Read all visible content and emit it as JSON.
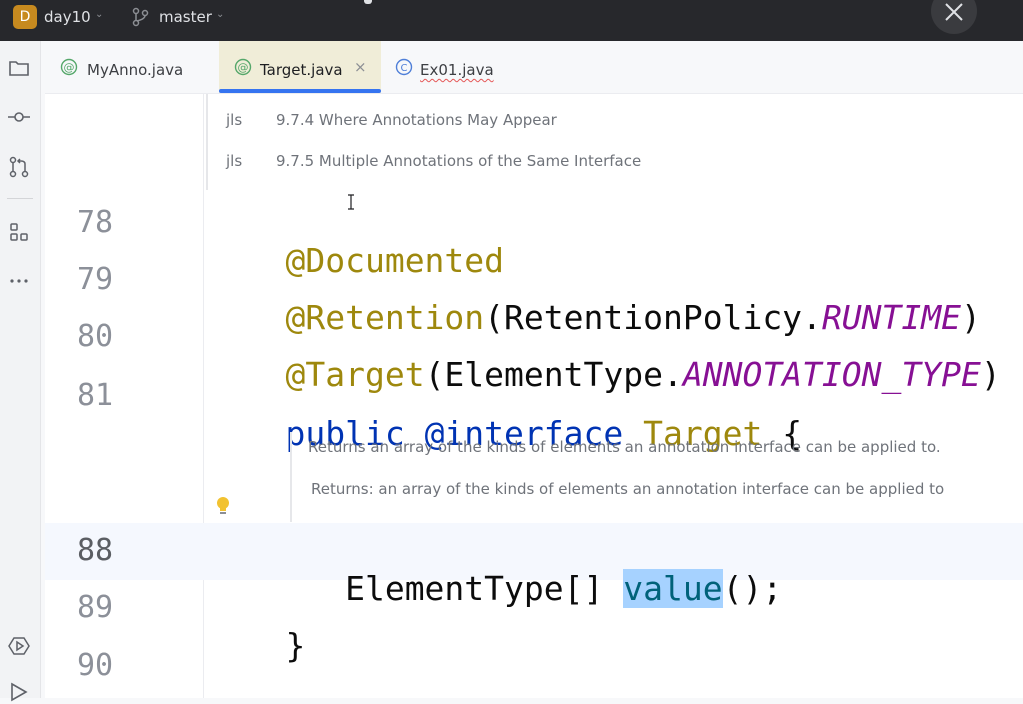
{
  "titlebar": {
    "project_badge": "D",
    "project_name": "day10",
    "branch_name": "master",
    "icons": [
      "branch-icon",
      "close-icon"
    ]
  },
  "left_toolbar": {
    "icons": [
      "folder-icon",
      "commit-icon",
      "pull-requests-icon",
      "structure-icon",
      "more-icon",
      "services-icon",
      "run-icon"
    ]
  },
  "tabs": [
    {
      "label": "MyAnno.java",
      "icon": "annotation-icon",
      "active": false
    },
    {
      "label": "Target.java",
      "icon": "annotation-icon",
      "active": true,
      "close": "×"
    },
    {
      "label": "Ex01.java",
      "icon": "class-icon",
      "active": false,
      "has_error": true
    }
  ],
  "jls_refs": [
    {
      "tag": "jls",
      "text": "9.7.4 Where Annotations May Appear"
    },
    {
      "tag": "jls",
      "text": "9.7.5 Multiple Annotations of the Same Interface"
    }
  ],
  "code_lines": [
    {
      "num": "78",
      "parts": [
        {
          "t": "@Documented",
          "c": "ann"
        }
      ]
    },
    {
      "num": "79",
      "parts": [
        {
          "t": "@Retention",
          "c": "ann"
        },
        {
          "t": "(RetentionPolicy.",
          "c": "cls"
        },
        {
          "t": "RUNTIME",
          "c": "const"
        },
        {
          "t": ")",
          "c": "cls"
        }
      ]
    },
    {
      "num": "80",
      "parts": [
        {
          "t": "@Target",
          "c": "ann"
        },
        {
          "t": "(ElementType.",
          "c": "cls"
        },
        {
          "t": "ANNOTATION_TYPE",
          "c": "const"
        },
        {
          "t": ")",
          "c": "cls"
        }
      ]
    },
    {
      "num": "81",
      "parts": [
        {
          "t": "public ",
          "c": "kw"
        },
        {
          "t": "@interface ",
          "c": "kw"
        },
        {
          "t": "Target",
          "c": "tname"
        },
        {
          "t": " {",
          "c": "cls"
        }
      ]
    },
    {
      "num": "88",
      "parts": [
        {
          "t": "   ElementType[] ",
          "c": "cls"
        },
        {
          "t": "value",
          "c": "method"
        },
        {
          "t": "();",
          "c": "cls"
        }
      ]
    },
    {
      "num": "89",
      "parts": [
        {
          "t": "}",
          "c": "cls"
        }
      ]
    },
    {
      "num": "90",
      "parts": []
    }
  ],
  "doc_comment": {
    "summary": "Returns an array of the kinds of elements an annotation interface can be applied to.",
    "returns": "Returns: an array of the kinds of elements an annotation interface can be applied to"
  },
  "colors": {
    "annotation": "#9e880d",
    "keyword": "#0033b3",
    "constant": "#871094",
    "method": "#00627a",
    "selection": "#a6d2ff",
    "tab_active_underline": "#3574f0"
  }
}
